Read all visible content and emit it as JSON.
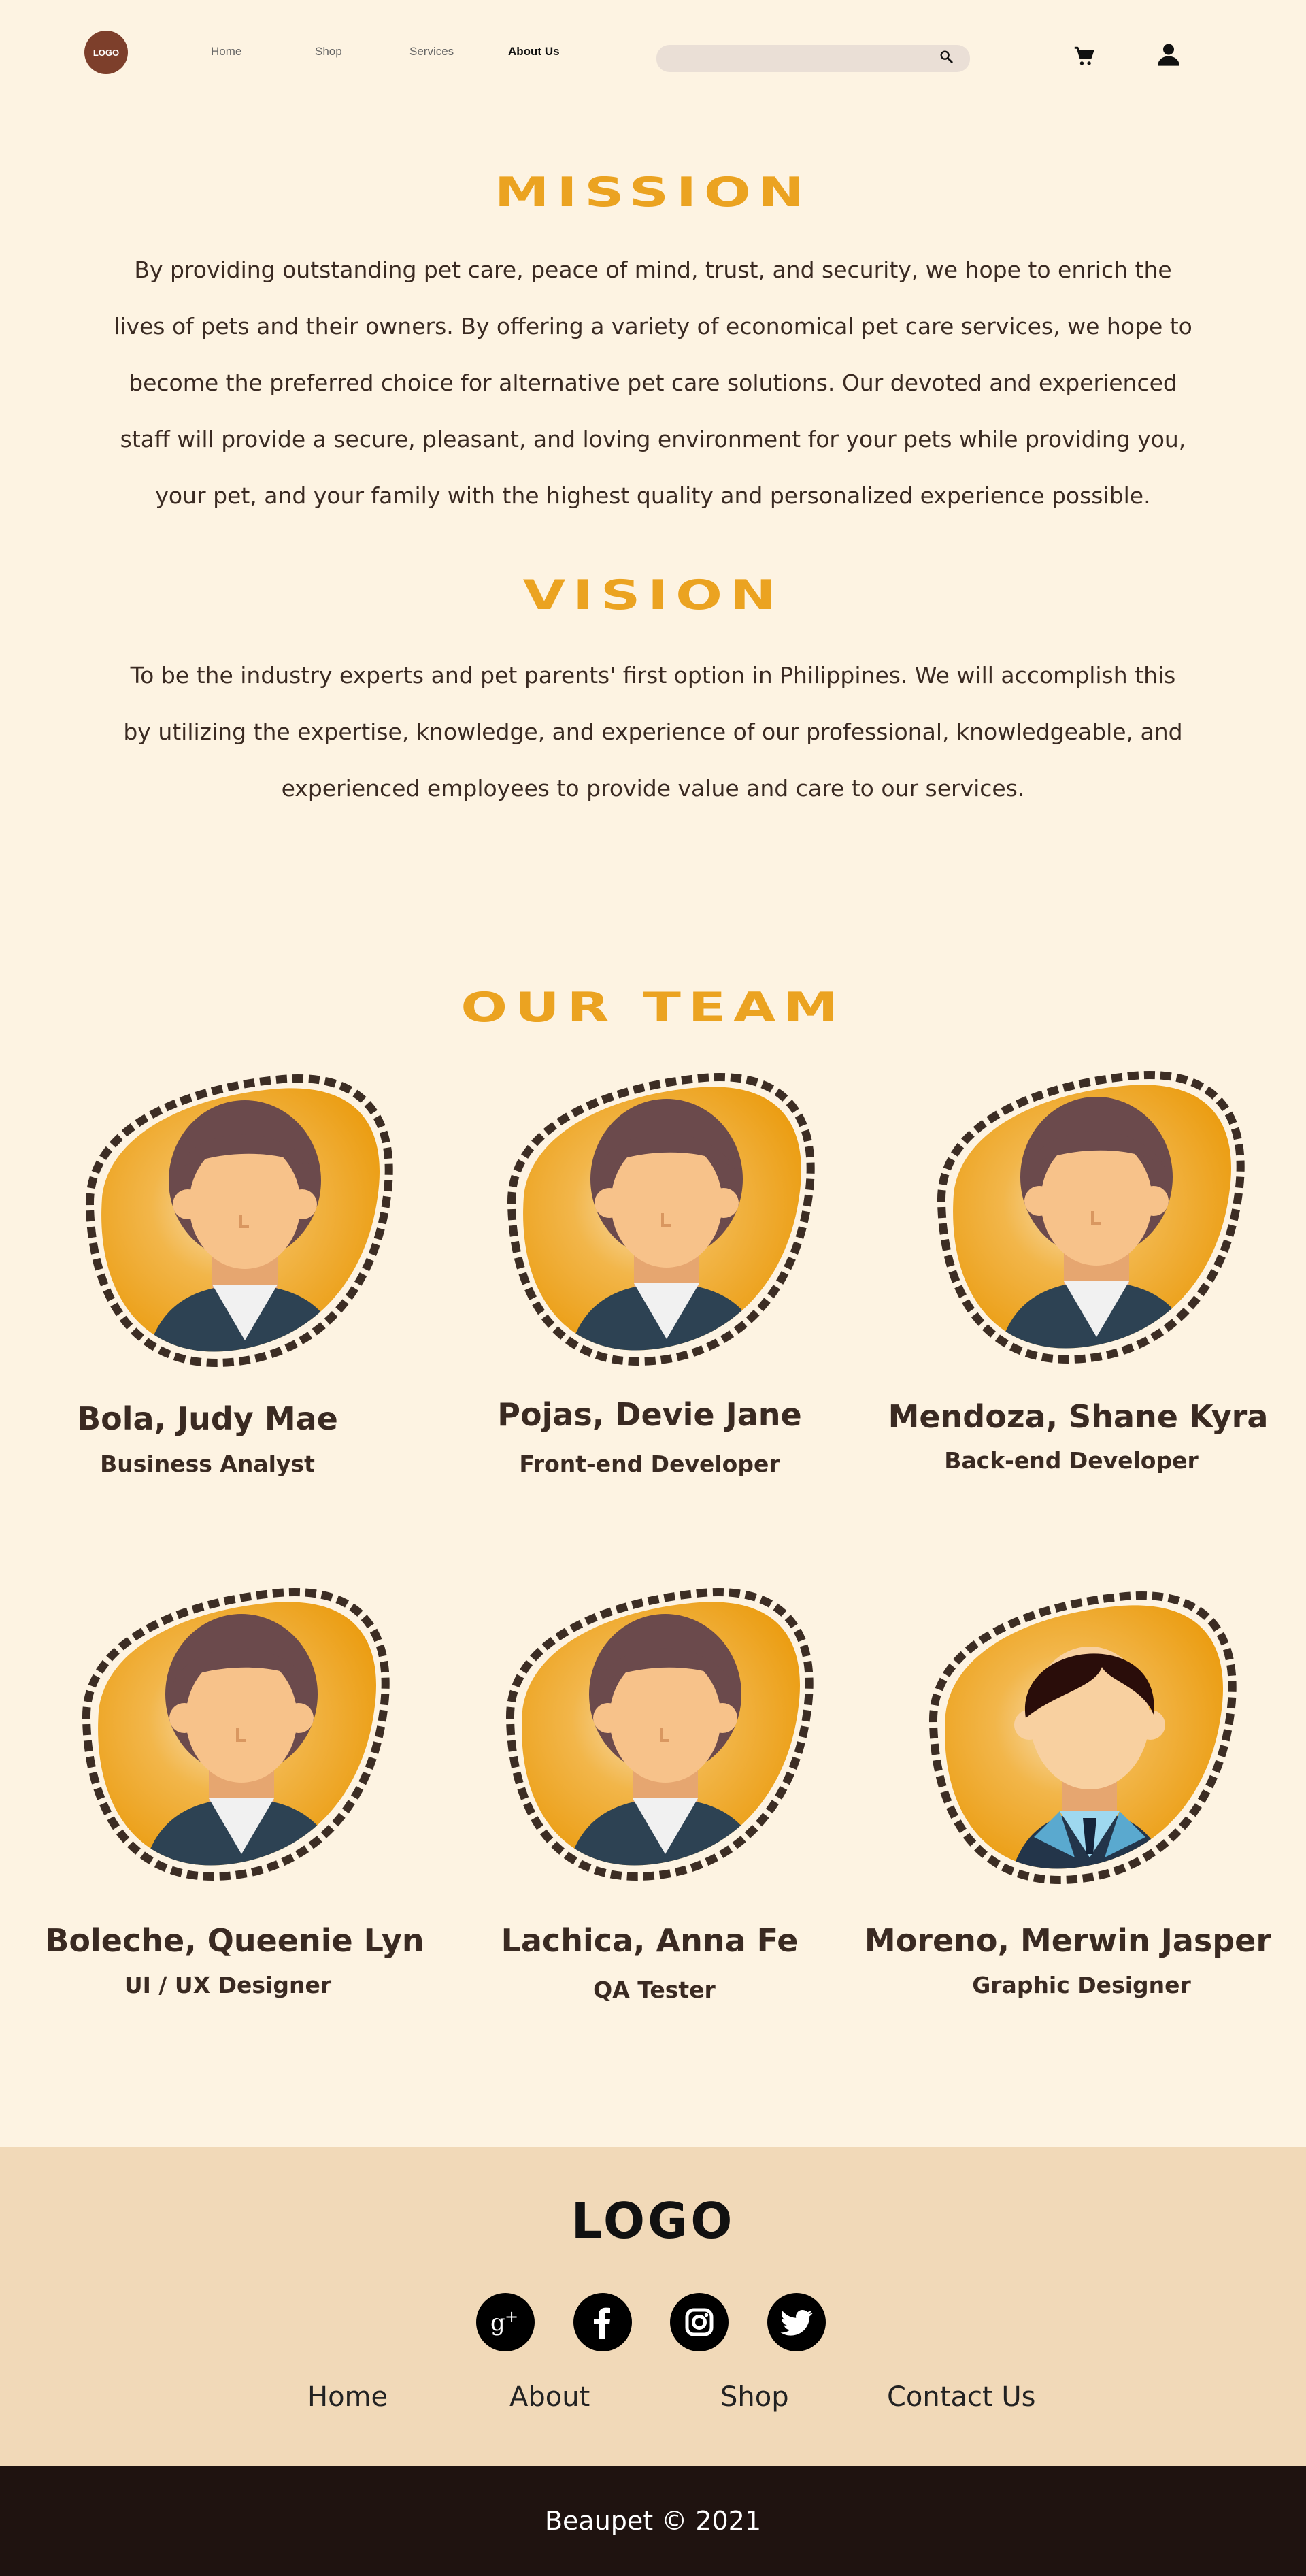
{
  "nav": {
    "logo": "LOGO",
    "links": [
      "Home",
      "Shop",
      "Services",
      "About Us"
    ],
    "search_placeholder": ""
  },
  "mission": {
    "title": "MISSION",
    "lines": [
      "By providing outstanding pet care, peace of mind, trust, and security, we hope to enrich the",
      "lives of pets and their owners. By offering a variety of economical pet care services, we hope to",
      "become the preferred choice for alternative pet care solutions. Our devoted and experienced",
      "staff will provide a secure, pleasant, and loving environment for your pets while providing you,",
      "your pet, and your family with the highest quality and personalized experience possible."
    ]
  },
  "vision": {
    "title": "VISION",
    "lines": [
      "To be the industry experts and pet parents' first option in Philippines. We will accomplish this",
      "by utilizing the expertise, knowledge, and experience of our professional, knowledgeable, and",
      "experienced employees to provide value and care to our services."
    ]
  },
  "team": {
    "title": "OUR TEAM",
    "members": [
      {
        "name": "Bola, Judy Mae",
        "role": "Business Analyst"
      },
      {
        "name": "Pojas, Devie Jane",
        "role": "Front-end Developer"
      },
      {
        "name": "Mendoza, Shane Kyra",
        "role": "Back-end Developer"
      },
      {
        "name": "Boleche, Queenie Lyn",
        "role": "UI / UX Designer"
      },
      {
        "name": "Lachica, Anna Fe",
        "role": "QA Tester"
      },
      {
        "name": "Moreno, Merwin Jasper",
        "role": "Graphic Designer"
      }
    ]
  },
  "footer": {
    "logo": "LOGO",
    "social": [
      "google-plus-icon",
      "facebook-icon",
      "instagram-icon",
      "twitter-icon"
    ],
    "links": [
      "Home",
      "About",
      "Shop",
      "Contact Us"
    ],
    "copyright": "Beaupet © 2021"
  },
  "colors": {
    "background": "#fdf3e2",
    "accent": "#eba321",
    "text": "#3a2a22",
    "footer": "#f1d9b8",
    "bottom_bar": "#1f1310",
    "logo_circle": "#7d3f2b"
  }
}
